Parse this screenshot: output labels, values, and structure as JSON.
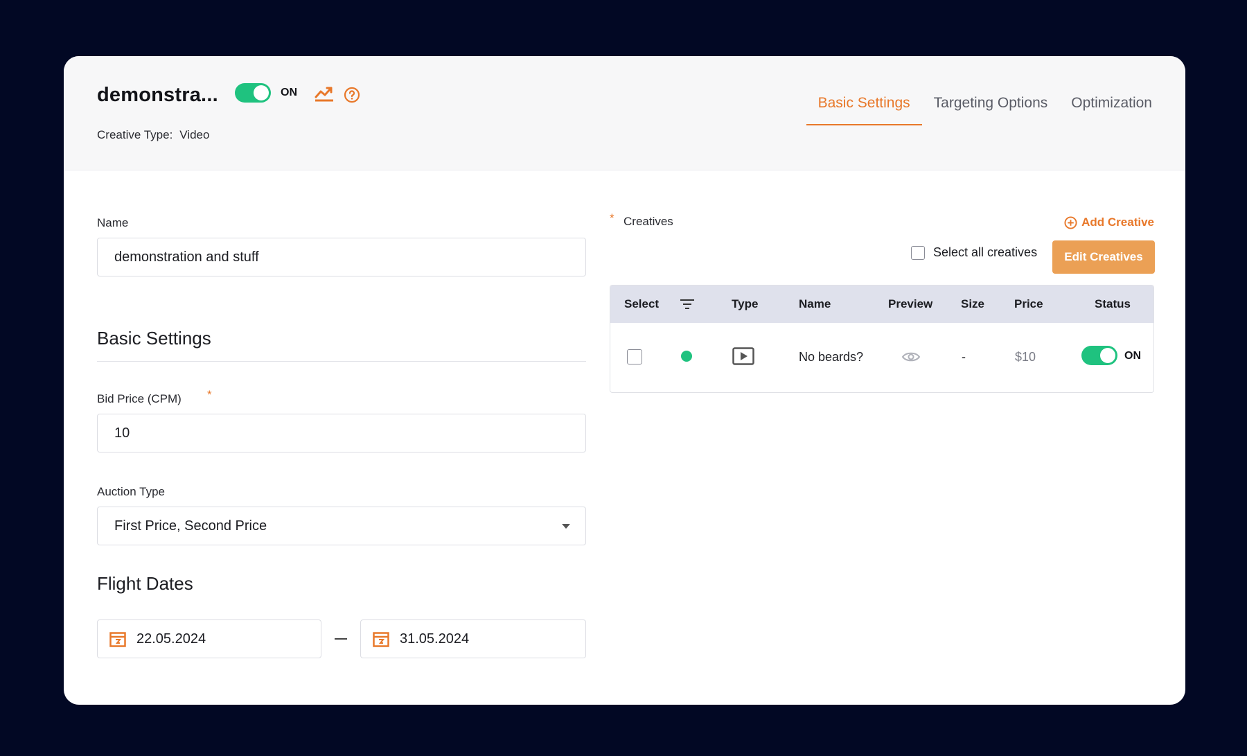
{
  "header": {
    "title": "demonstra...",
    "status_label": "ON",
    "creative_type_label": "Creative Type:",
    "creative_type_value": "Video",
    "tabs": [
      {
        "label": "Basic Settings",
        "active": true
      },
      {
        "label": "Targeting Options",
        "active": false
      },
      {
        "label": "Optimization",
        "active": false
      }
    ]
  },
  "form": {
    "name_label": "Name",
    "name_value": "demonstration and stuff",
    "basic_settings_title": "Basic Settings",
    "bid_price_label": "Bid Price (CPM)",
    "required_mark": "*",
    "bid_price_value": "10",
    "auction_type_label": "Auction Type",
    "auction_type_value": "First Price, Second Price",
    "flight_dates_title": "Flight Dates",
    "start_date": "22.05.2024",
    "end_date": "31.05.2024"
  },
  "creatives": {
    "label": "Creatives",
    "add_label": "Add Creative",
    "select_all_label": "Select all creatives",
    "edit_button_label": "Edit Creatives",
    "columns": [
      "Select",
      "Type",
      "Name",
      "Preview",
      "Size",
      "Price",
      "Status"
    ],
    "rows": [
      {
        "name": "No beards?",
        "size": "-",
        "price": "$10",
        "status": "ON"
      }
    ]
  },
  "colors": {
    "accent": "#e8782a",
    "toggle_on": "#1fc27f",
    "background": "#020824",
    "table_header": "#dfe1ec"
  },
  "icons": [
    "chart-icon",
    "help-icon",
    "calendar-icon",
    "add-circle-icon",
    "filter-icon",
    "video-play-icon",
    "eye-icon"
  ]
}
